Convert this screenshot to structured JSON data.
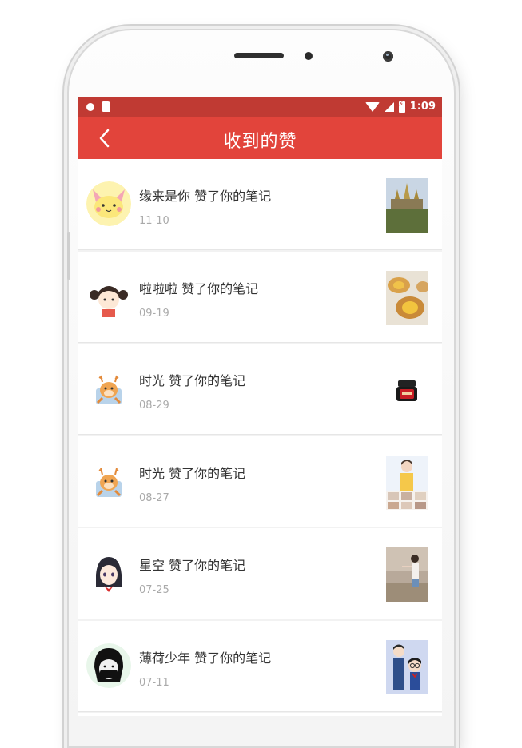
{
  "status_bar": {
    "time": "1:09"
  },
  "header": {
    "title": "收到的赞"
  },
  "notifications": [
    {
      "user": "缘来是你",
      "action": "赞了你的笔记",
      "date": "11-10",
      "avatar_icon": "pikachu-avatar-icon",
      "thumb_icon": "palace-photo-icon"
    },
    {
      "user": "啦啦啦",
      "action": "赞了你的笔记",
      "date": "09-19",
      "avatar_icon": "girl-avatar-icon",
      "thumb_icon": "egg-tart-photo-icon"
    },
    {
      "user": "时光",
      "action": "赞了你的笔记",
      "date": "08-29",
      "avatar_icon": "deer-avatar-icon",
      "thumb_icon": "cosmetic-jar-photo-icon"
    },
    {
      "user": "时光",
      "action": "赞了你的笔记",
      "date": "08-27",
      "avatar_icon": "deer-avatar-icon",
      "thumb_icon": "woman-collage-photo-icon"
    },
    {
      "user": "星空",
      "action": "赞了你的笔记",
      "date": "07-25",
      "avatar_icon": "anime-girl-avatar-icon",
      "thumb_icon": "wall-photo-icon"
    },
    {
      "user": "薄荷少年",
      "action": "赞了你的笔记",
      "date": "07-11",
      "avatar_icon": "masked-boy-avatar-icon",
      "thumb_icon": "detective-photo-icon"
    }
  ],
  "colors": {
    "status_bar": "#c03a33",
    "header": "#e2443b",
    "accent": "#e2443b"
  }
}
